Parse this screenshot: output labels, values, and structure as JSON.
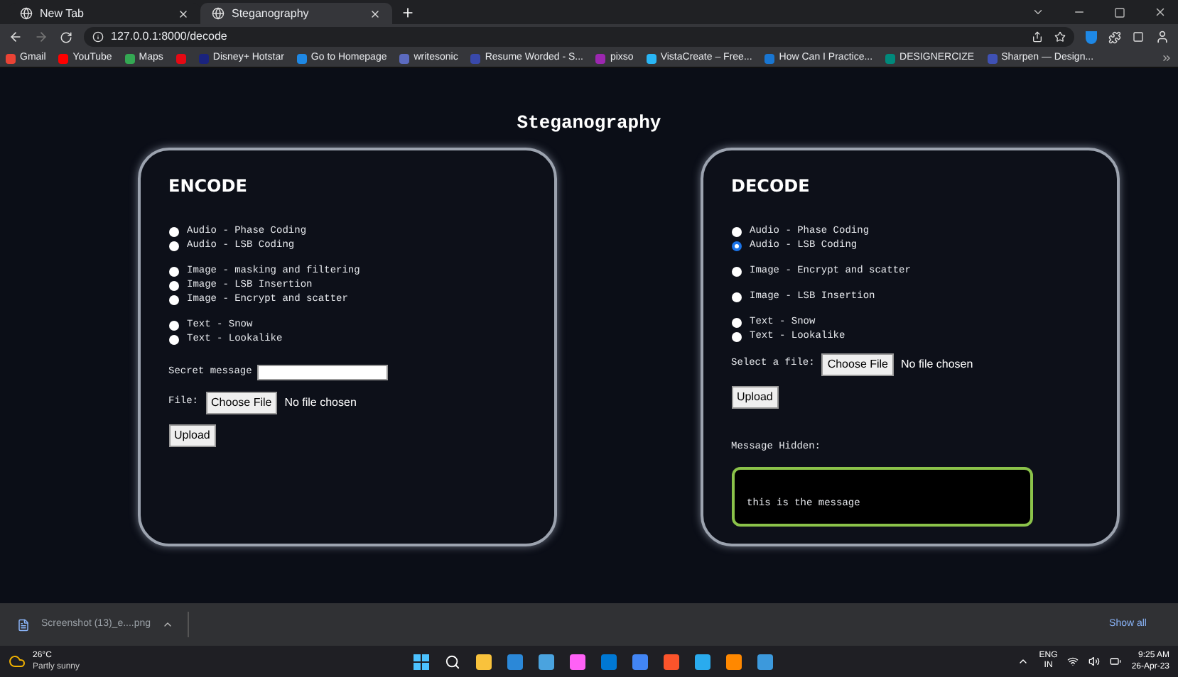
{
  "browser": {
    "tabs": [
      {
        "title": "New Tab",
        "selected": false
      },
      {
        "title": "Steganography",
        "selected": true
      }
    ],
    "address": "127.0.0.1:8000/decode",
    "bookmarks": [
      {
        "kind": "link",
        "label": "Gmail"
      },
      {
        "kind": "link",
        "label": "YouTube"
      },
      {
        "kind": "link",
        "label": "Maps"
      },
      {
        "kind": "icon"
      },
      {
        "kind": "link",
        "label": "Disney+ Hotstar"
      },
      {
        "kind": "link",
        "label": "Go to Homepage"
      },
      {
        "kind": "link",
        "label": "writesonic"
      },
      {
        "kind": "link",
        "label": "Resume Worded - S..."
      },
      {
        "kind": "link",
        "label": "pixso"
      },
      {
        "kind": "link",
        "label": "VistaCreate – Free..."
      },
      {
        "kind": "link",
        "label": "How Can I Practice..."
      },
      {
        "kind": "link",
        "label": "DESIGNERCIZE"
      },
      {
        "kind": "link",
        "label": "Sharpen — Design..."
      }
    ]
  },
  "page": {
    "title": "Steganography",
    "encode": {
      "heading": "ENCODE",
      "groups": [
        [
          {
            "label": "Audio - Phase Coding",
            "selected": false
          },
          {
            "label": "Audio - LSB Coding",
            "selected": false
          }
        ],
        [
          {
            "label": "Image - masking and filtering",
            "selected": false
          },
          {
            "label": "Image - LSB Insertion",
            "selected": false
          },
          {
            "label": "Image - Encrypt and scatter",
            "selected": false
          }
        ],
        [
          {
            "label": "Text - Snow",
            "selected": false
          },
          {
            "label": "Text - Lookalike",
            "selected": false
          }
        ]
      ],
      "secret_label": "Secret message",
      "file_label": "File:",
      "choose_button": "Choose File",
      "file_status": "No file chosen",
      "upload_button": "Upload"
    },
    "decode": {
      "heading": "DECODE",
      "groups": [
        [
          {
            "label": "Audio - Phase Coding",
            "selected": false
          },
          {
            "label": "Audio - LSB Coding",
            "selected": true
          }
        ],
        [
          {
            "label": "Image - Encrypt and scatter",
            "selected": false
          }
        ],
        [
          {
            "label": "Image - LSB Insertion",
            "selected": false
          }
        ],
        [
          {
            "label": "Text - Snow",
            "selected": false
          },
          {
            "label": "Text - Lookalike",
            "selected": false
          }
        ]
      ],
      "file_label": "Select a file:",
      "choose_button": "Choose File",
      "file_status": "No file chosen",
      "upload_button": "Upload",
      "result_label": "Message Hidden:",
      "result_text": "this is the message"
    }
  },
  "downloads": {
    "file": "Screenshot (13)_e....png",
    "show_all": "Show all"
  },
  "taskbar": {
    "temperature": "26°C",
    "weather": "Partly sunny",
    "language": "ENG",
    "region": "IN",
    "time": "9:25 AM",
    "date": "26-Apr-23"
  }
}
